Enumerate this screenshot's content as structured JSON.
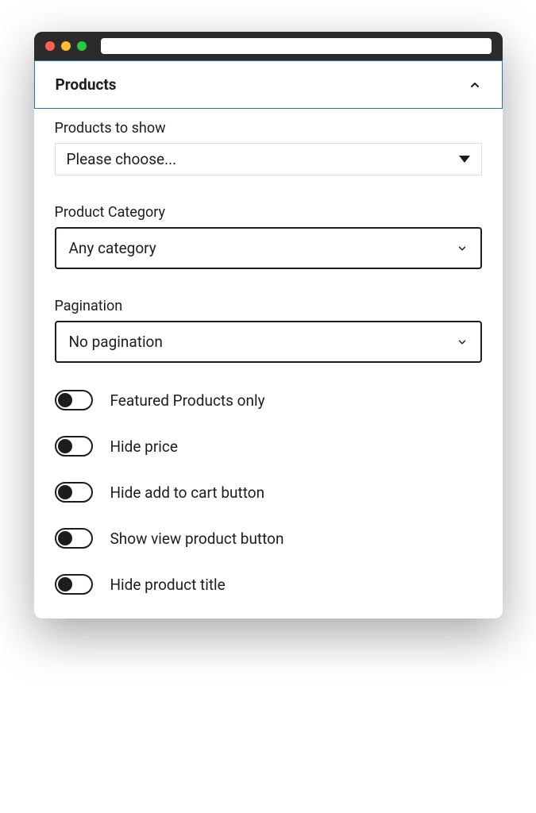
{
  "panel": {
    "title": "Products"
  },
  "fields": {
    "products_to_show": {
      "label": "Products to show",
      "value": "Please choose..."
    },
    "product_category": {
      "label": "Product Category",
      "value": "Any category"
    },
    "pagination": {
      "label": "Pagination",
      "value": "No pagination"
    }
  },
  "toggles": [
    {
      "label": "Featured Products only",
      "on": false
    },
    {
      "label": "Hide price",
      "on": false
    },
    {
      "label": "Hide add to cart button",
      "on": false
    },
    {
      "label": "Show view product button",
      "on": false
    },
    {
      "label": "Hide product title",
      "on": false
    }
  ]
}
